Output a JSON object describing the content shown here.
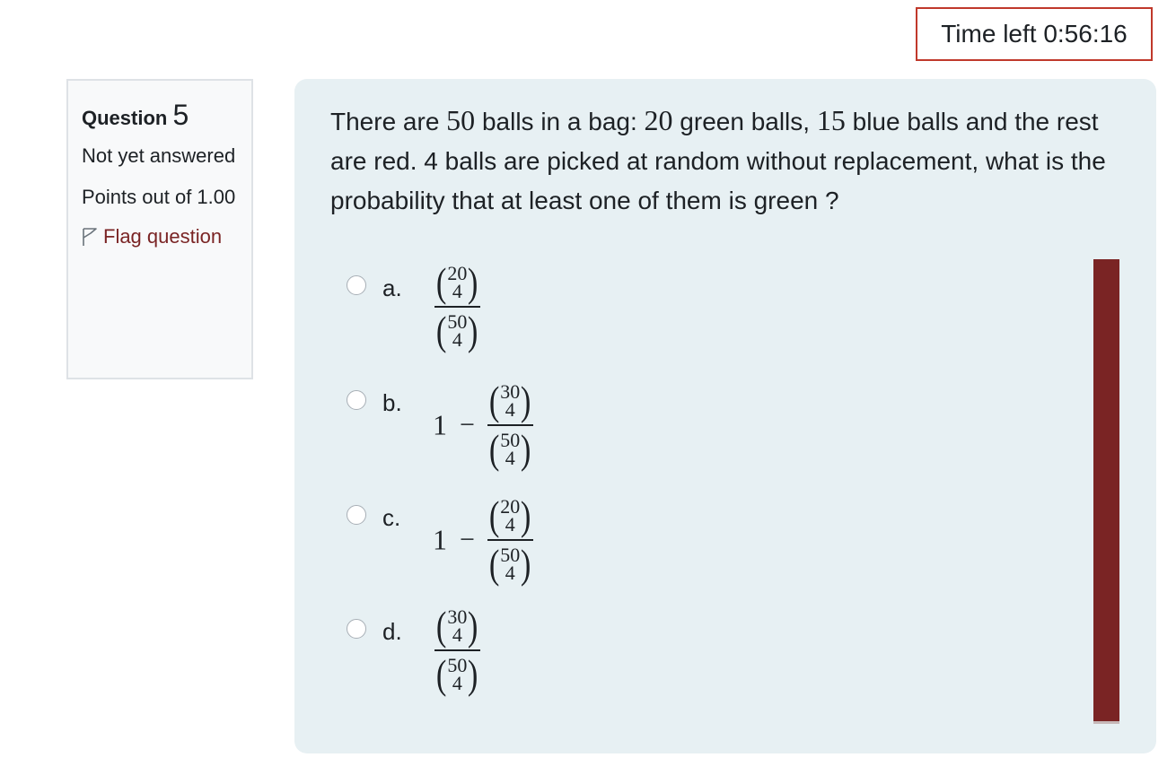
{
  "timer": {
    "label": "Time left",
    "value": "0:56:16"
  },
  "info": {
    "question_label": "Question",
    "question_number": "5",
    "state": "Not yet answered",
    "grade": "Points out of 1.00",
    "flag_label": "Flag question"
  },
  "question": {
    "text_parts": [
      "There are ",
      "50",
      " balls in a bag: ",
      "20",
      " green balls, ",
      "15",
      " blue balls and the rest are red. 4 balls are picked at random without replacement, what is the probability that at least one of them is green ?"
    ]
  },
  "options": [
    {
      "letter": "a.",
      "prefix": "",
      "num_top": "20",
      "num_bottom": "4",
      "den_top": "50",
      "den_bottom": "4"
    },
    {
      "letter": "b.",
      "prefix": "1",
      "minus": "−",
      "num_top": "30",
      "num_bottom": "4",
      "den_top": "50",
      "den_bottom": "4"
    },
    {
      "letter": "c.",
      "prefix": "1",
      "minus": "−",
      "num_top": "20",
      "num_bottom": "4",
      "den_top": "50",
      "den_bottom": "4"
    },
    {
      "letter": "d.",
      "prefix": "",
      "num_top": "30",
      "num_bottom": "4",
      "den_top": "50",
      "den_bottom": "4"
    }
  ],
  "colors": {
    "accent": "#7a2424",
    "timer_border": "#c0392b",
    "panel_bg": "#e7f0f3"
  }
}
